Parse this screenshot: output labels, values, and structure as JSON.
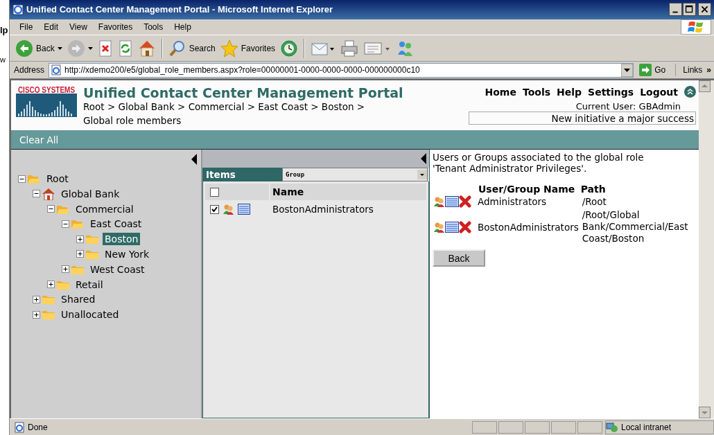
{
  "background_window": {
    "texts": [
      "lp",
      "w"
    ]
  },
  "window": {
    "title": "Unified Contact Center Management Portal - Microsoft Internet Explorer"
  },
  "menu": [
    "File",
    "Edit",
    "View",
    "Favorites",
    "Tools",
    "Help"
  ],
  "toolbar": [
    {
      "kind": "back",
      "label": "Back"
    },
    {
      "kind": "forward"
    },
    {
      "kind": "stop"
    },
    {
      "kind": "refresh"
    },
    {
      "kind": "home"
    },
    {
      "kind": "search",
      "label": "Search"
    },
    {
      "kind": "favorites",
      "label": "Favorites"
    },
    {
      "kind": "history"
    },
    {
      "kind": "mail"
    },
    {
      "kind": "print"
    },
    {
      "kind": "edit"
    },
    {
      "kind": "messenger"
    }
  ],
  "address_bar": {
    "label": "Address",
    "url": "http://xdemo200/e5/global_role_members.aspx?role=00000001-0000-0000-0000-000000000c10",
    "go": "Go",
    "links": "Links",
    "chevron": "»"
  },
  "portal": {
    "brand": "CISCO SYSTEMS",
    "title": "Unified Contact Center Management Portal",
    "breadcrumb": "Root > Global Bank > Commercial > East Coast > Boston >",
    "page": "Global role members",
    "nav": [
      "Home",
      "Tools",
      "Help",
      "Settings",
      "Logout"
    ],
    "current_user": "Current User: GBAdmin",
    "ticker": "New initiative a major success"
  },
  "action_bar": [
    "Clear All"
  ],
  "tree": [
    {
      "label": "Root",
      "kind": "folder",
      "expanded": true,
      "selected": false,
      "children": [
        {
          "label": "Global Bank",
          "kind": "home",
          "expanded": true,
          "selected": false,
          "children": [
            {
              "label": "Commercial",
              "kind": "folder",
              "expanded": true,
              "selected": false,
              "children": [
                {
                  "label": "East Coast",
                  "kind": "folder",
                  "expanded": true,
                  "selected": false,
                  "children": [
                    {
                      "label": "Boston",
                      "kind": "folder",
                      "expanded": false,
                      "selected": true
                    },
                    {
                      "label": "New York",
                      "kind": "folder",
                      "expanded": false,
                      "selected": false
                    }
                  ]
                },
                {
                  "label": "West Coast",
                  "kind": "folder",
                  "expanded": false,
                  "selected": false
                }
              ]
            },
            {
              "label": "Retail",
              "kind": "folder",
              "expanded": false,
              "selected": false
            }
          ]
        },
        {
          "label": "Shared",
          "kind": "folder",
          "expanded": false,
          "selected": false
        },
        {
          "label": "Unallocated",
          "kind": "folder",
          "expanded": false,
          "selected": false
        }
      ]
    }
  ],
  "items_panel": {
    "title": "Items",
    "filter": "Group",
    "header_checked": false,
    "columns": [
      "Name"
    ],
    "rows": [
      {
        "checked": true,
        "name": "BostonAdministrators"
      }
    ]
  },
  "details": {
    "intro": "Users or Groups associated to the global role 'Tenant Administrator Privileges'.",
    "columns": [
      "User/Group Name",
      "Path"
    ],
    "rows": [
      {
        "name": "Administrators",
        "path": "/Root"
      },
      {
        "name": "BostonAdministrators",
        "path": "/Root/Global Bank/Commercial/East Coast/Boston"
      }
    ],
    "back": "Back"
  },
  "status_bar": {
    "text": "Done",
    "zone": "Local intranet"
  }
}
